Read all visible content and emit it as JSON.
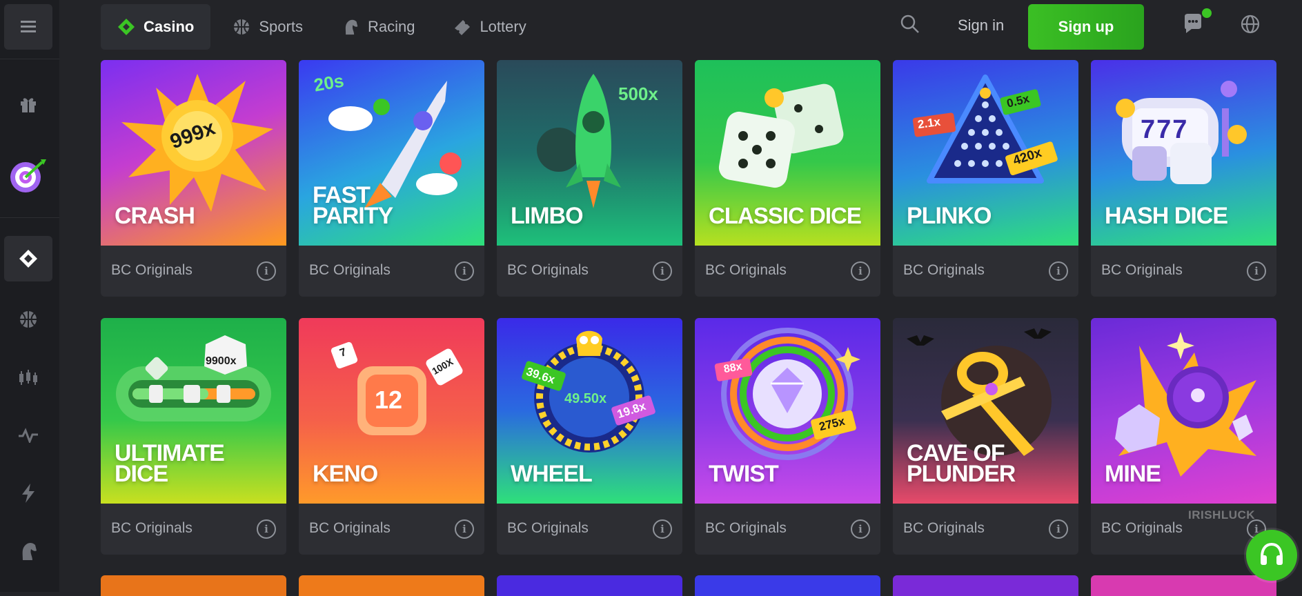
{
  "topnav": {
    "items": [
      {
        "label": "Casino",
        "icon": "casino-diamond-icon",
        "active": true
      },
      {
        "label": "Sports",
        "icon": "sports-ball-icon",
        "active": false
      },
      {
        "label": "Racing",
        "icon": "horse-head-icon",
        "active": false
      },
      {
        "label": "Lottery",
        "icon": "ticket-icon",
        "active": false
      }
    ],
    "signin_label": "Sign in",
    "signup_label": "Sign up"
  },
  "sidebar": {
    "items": [
      "menu-icon",
      "gift-icon",
      "target-promo-icon",
      "casino-chip-icon",
      "basketball-icon",
      "candlestick-icon",
      "activity-icon",
      "lightning-icon",
      "horse-head-icon"
    ]
  },
  "games": [
    {
      "title_line1": "CRASH",
      "title_line2": "",
      "provider": "BC Originals",
      "art_text": "999x"
    },
    {
      "title_line1": "FAST",
      "title_line2": "PARITY",
      "provider": "BC Originals",
      "art_text": "20s"
    },
    {
      "title_line1": "LIMBO",
      "title_line2": "",
      "provider": "BC Originals",
      "art_text": "500x"
    },
    {
      "title_line1": "CLASSIC DICE",
      "title_line2": "",
      "provider": "BC Originals",
      "art_text": ""
    },
    {
      "title_line1": "PLINKO",
      "title_line2": "",
      "provider": "BC Originals",
      "art_text": "2.1x"
    },
    {
      "title_line1": "HASH DICE",
      "title_line2": "",
      "provider": "BC Originals",
      "art_text": "777"
    },
    {
      "title_line1": "ULTIMATE",
      "title_line2": "DICE",
      "provider": "BC Originals",
      "art_text": "9900x"
    },
    {
      "title_line1": "KENO",
      "title_line2": "",
      "provider": "BC Originals",
      "art_text": "12"
    },
    {
      "title_line1": "WHEEL",
      "title_line2": "",
      "provider": "BC Originals",
      "art_text": "49.50x"
    },
    {
      "title_line1": "TWIST",
      "title_line2": "",
      "provider": "BC Originals",
      "art_text": "88x"
    },
    {
      "title_line1": "CAVE OF",
      "title_line2": "PLUNDER",
      "provider": "BC Originals",
      "art_text": ""
    },
    {
      "title_line1": "MINE",
      "title_line2": "",
      "provider": "BC Originals",
      "art_text": ""
    }
  ],
  "art_extras": {
    "plinko_a": "0.5x",
    "plinko_b": "420x",
    "keno_a": "7",
    "keno_b": "100X",
    "wheel_a": "39.6x",
    "wheel_b": "19.8x",
    "twist_b": "275x"
  },
  "info_glyph": "i",
  "watermark": "IRISHLUCK",
  "colors": {
    "accent_green": "#3bc624",
    "card_bg": "#2d2e33",
    "page_bg": "#232428"
  }
}
